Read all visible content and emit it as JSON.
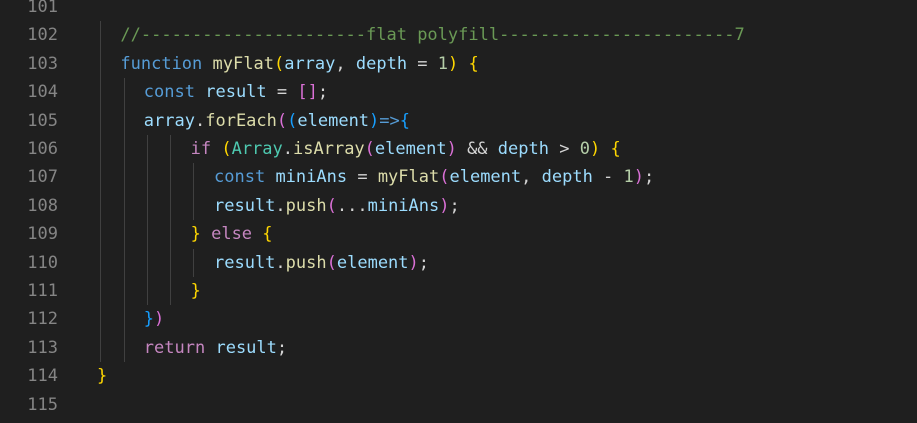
{
  "theme": {
    "background": "#1f1f1f",
    "line_number": "#858585"
  },
  "lines": [
    {
      "n": "101",
      "indent": 0,
      "guides": [],
      "tokens": []
    },
    {
      "n": "102",
      "indent": 1,
      "guides": [
        100
      ],
      "tokens": [
        {
          "t": "//----------------------flat polyfill-----------------------7",
          "c": "comment"
        }
      ]
    },
    {
      "n": "103",
      "indent": 1,
      "guides": [
        100
      ],
      "tokens": [
        {
          "t": "function",
          "c": "kw"
        },
        {
          "t": " ",
          "c": "plain"
        },
        {
          "t": "myFlat",
          "c": "fn"
        },
        {
          "t": "(",
          "c": "b1"
        },
        {
          "t": "array",
          "c": "var"
        },
        {
          "t": ", ",
          "c": "plain"
        },
        {
          "t": "depth",
          "c": "var"
        },
        {
          "t": " = ",
          "c": "plain"
        },
        {
          "t": "1",
          "c": "num"
        },
        {
          "t": ")",
          "c": "b1"
        },
        {
          "t": " ",
          "c": "plain"
        },
        {
          "t": "{",
          "c": "b1"
        }
      ]
    },
    {
      "n": "104",
      "indent": 2,
      "guides": [
        100,
        124
      ],
      "tokens": [
        {
          "t": "const",
          "c": "kw"
        },
        {
          "t": " ",
          "c": "plain"
        },
        {
          "t": "result",
          "c": "var"
        },
        {
          "t": " = ",
          "c": "plain"
        },
        {
          "t": "[]",
          "c": "b2"
        },
        {
          "t": ";",
          "c": "plain"
        }
      ]
    },
    {
      "n": "105",
      "indent": 2,
      "guides": [
        100,
        124
      ],
      "tokens": [
        {
          "t": "array",
          "c": "var"
        },
        {
          "t": ".",
          "c": "plain"
        },
        {
          "t": "forEach",
          "c": "fn"
        },
        {
          "t": "(",
          "c": "b2"
        },
        {
          "t": "(",
          "c": "b3"
        },
        {
          "t": "element",
          "c": "var"
        },
        {
          "t": ")",
          "c": "b3"
        },
        {
          "t": "=>",
          "c": "kw"
        },
        {
          "t": "{",
          "c": "b3"
        }
      ]
    },
    {
      "n": "106",
      "indent": 4,
      "guides": [
        100,
        124,
        147,
        170
      ],
      "tokens": [
        {
          "t": "if",
          "c": "ctrl"
        },
        {
          "t": " ",
          "c": "plain"
        },
        {
          "t": "(",
          "c": "b1"
        },
        {
          "t": "Array",
          "c": "class"
        },
        {
          "t": ".",
          "c": "plain"
        },
        {
          "t": "isArray",
          "c": "fn"
        },
        {
          "t": "(",
          "c": "b2"
        },
        {
          "t": "element",
          "c": "var"
        },
        {
          "t": ")",
          "c": "b2"
        },
        {
          "t": " && ",
          "c": "plain"
        },
        {
          "t": "depth",
          "c": "var"
        },
        {
          "t": " > ",
          "c": "plain"
        },
        {
          "t": "0",
          "c": "num"
        },
        {
          "t": ")",
          "c": "b1"
        },
        {
          "t": " ",
          "c": "plain"
        },
        {
          "t": "{",
          "c": "b1"
        }
      ]
    },
    {
      "n": "107",
      "indent": 5,
      "guides": [
        100,
        124,
        147,
        170,
        193
      ],
      "tokens": [
        {
          "t": "const",
          "c": "kw"
        },
        {
          "t": " ",
          "c": "plain"
        },
        {
          "t": "miniAns",
          "c": "var"
        },
        {
          "t": " = ",
          "c": "plain"
        },
        {
          "t": "myFlat",
          "c": "fn"
        },
        {
          "t": "(",
          "c": "b2"
        },
        {
          "t": "element",
          "c": "var"
        },
        {
          "t": ", ",
          "c": "plain"
        },
        {
          "t": "depth",
          "c": "var"
        },
        {
          "t": " - ",
          "c": "plain"
        },
        {
          "t": "1",
          "c": "num"
        },
        {
          "t": ")",
          "c": "b2"
        },
        {
          "t": ";",
          "c": "plain"
        }
      ]
    },
    {
      "n": "108",
      "indent": 5,
      "guides": [
        100,
        124,
        147,
        170,
        193
      ],
      "tokens": [
        {
          "t": "result",
          "c": "var"
        },
        {
          "t": ".",
          "c": "plain"
        },
        {
          "t": "push",
          "c": "fn"
        },
        {
          "t": "(",
          "c": "b2"
        },
        {
          "t": "...",
          "c": "plain"
        },
        {
          "t": "miniAns",
          "c": "var"
        },
        {
          "t": ")",
          "c": "b2"
        },
        {
          "t": ";",
          "c": "plain"
        }
      ]
    },
    {
      "n": "109",
      "indent": 4,
      "guides": [
        100,
        124,
        147,
        170
      ],
      "tokens": [
        {
          "t": "}",
          "c": "b1"
        },
        {
          "t": " ",
          "c": "plain"
        },
        {
          "t": "else",
          "c": "ctrl"
        },
        {
          "t": " ",
          "c": "plain"
        },
        {
          "t": "{",
          "c": "b1"
        }
      ]
    },
    {
      "n": "110",
      "indent": 5,
      "guides": [
        100,
        124,
        147,
        170,
        193
      ],
      "tokens": [
        {
          "t": "result",
          "c": "var"
        },
        {
          "t": ".",
          "c": "plain"
        },
        {
          "t": "push",
          "c": "fn"
        },
        {
          "t": "(",
          "c": "b2"
        },
        {
          "t": "element",
          "c": "var"
        },
        {
          "t": ")",
          "c": "b2"
        },
        {
          "t": ";",
          "c": "plain"
        }
      ]
    },
    {
      "n": "111",
      "indent": 4,
      "guides": [
        100,
        124,
        147,
        170
      ],
      "tokens": [
        {
          "t": "}",
          "c": "b1"
        }
      ]
    },
    {
      "n": "112",
      "indent": 2,
      "guides": [
        100,
        124
      ],
      "tokens": [
        {
          "t": "}",
          "c": "b3"
        },
        {
          "t": ")",
          "c": "b2"
        }
      ]
    },
    {
      "n": "113",
      "indent": 2,
      "guides": [
        100,
        124
      ],
      "tokens": [
        {
          "t": "return",
          "c": "ctrl"
        },
        {
          "t": " ",
          "c": "plain"
        },
        {
          "t": "result",
          "c": "var"
        },
        {
          "t": ";",
          "c": "plain"
        }
      ]
    },
    {
      "n": "114",
      "indent": 0,
      "guides": [],
      "tokens": [
        {
          "t": "}",
          "c": "b1"
        }
      ]
    },
    {
      "n": "115",
      "indent": 0,
      "guides": [],
      "tokens": []
    }
  ]
}
